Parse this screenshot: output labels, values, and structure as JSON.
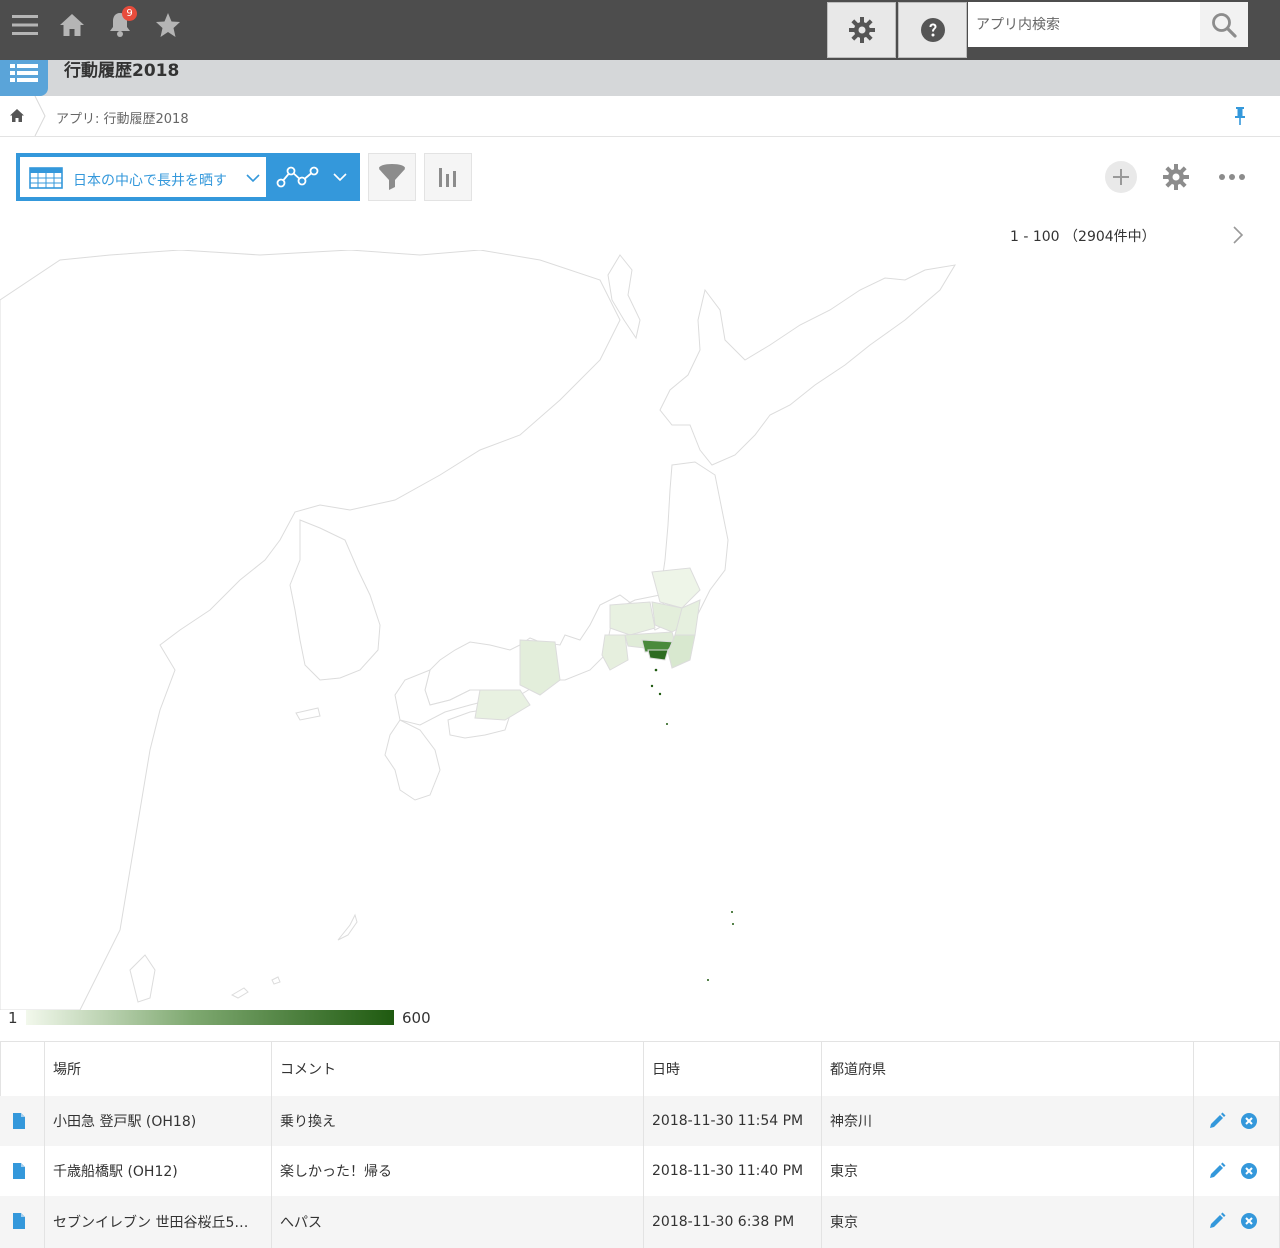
{
  "topbar": {
    "notification_count": "9",
    "search_placeholder": "アプリ内検索",
    "icons": [
      "menu-icon",
      "home-icon",
      "bell-icon",
      "star-icon",
      "gear-icon",
      "help-icon",
      "search-icon"
    ]
  },
  "app": {
    "title": "行動履歴2018",
    "breadcrumb": "アプリ: 行動履歴2018"
  },
  "toolbar": {
    "view_label": "日本の中心で長井を晒す"
  },
  "pagination": {
    "text": "1 - 100 （2904件中）"
  },
  "map_legend": {
    "min": "1",
    "max": "600",
    "color_low": "#f2f8ec",
    "color_high": "#1f5a10"
  },
  "table": {
    "headers": [
      "場所",
      "コメント",
      "日時",
      "都道府県"
    ],
    "rows": [
      {
        "place": "小田急 登戸駅 (OH18)",
        "comment": "乗り換え",
        "datetime": "2018-11-30 11:54 PM",
        "prefecture": "神奈川"
      },
      {
        "place": "千歳船橋駅 (OH12)",
        "comment": "楽しかった！帰る",
        "datetime": "2018-11-30 11:40 PM",
        "prefecture": "東京"
      },
      {
        "place": "セブンイレブン 世田谷桜丘5…",
        "comment": "へパス",
        "datetime": "2018-11-30 6:38 PM",
        "prefecture": "東京"
      }
    ]
  },
  "colors": {
    "accent": "#3498db",
    "topbar": "#4d4d4d",
    "badge": "#e74c3c"
  }
}
